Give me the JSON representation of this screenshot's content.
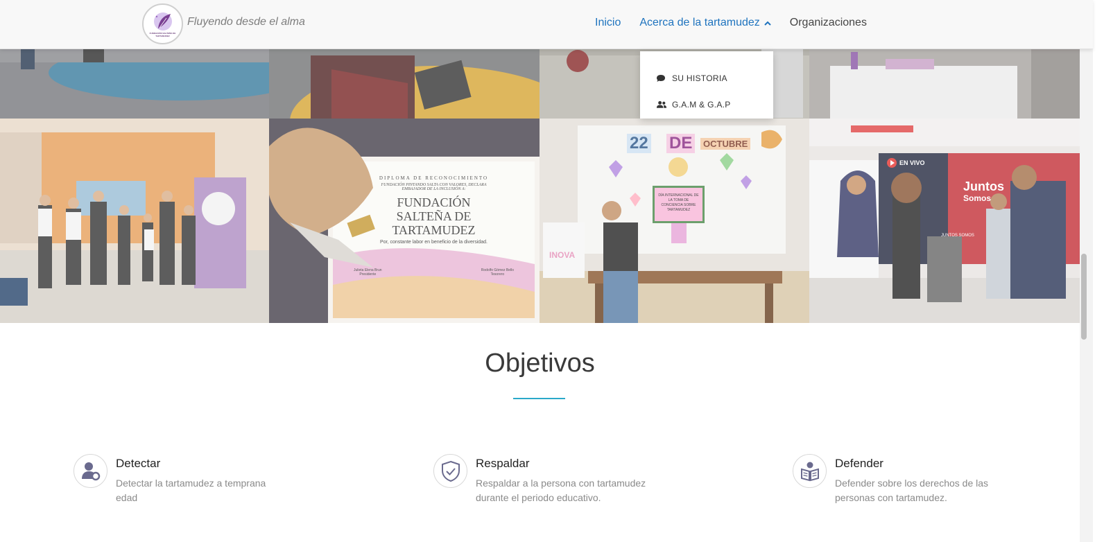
{
  "header": {
    "tagline": "Fluyendo desde el alma",
    "logo_text": "FUNDACIÓN SALTEÑA DE TARTAMUDEZ"
  },
  "nav": {
    "items": [
      {
        "label": "Inicio",
        "active": true
      },
      {
        "label": "Acerca de la tartamudez",
        "active": true,
        "expanded": true
      },
      {
        "label": "Organizaciones",
        "active": false
      }
    ]
  },
  "dropdown": {
    "items": [
      {
        "label": "SU HISTORIA",
        "icon": "comment-icon"
      },
      {
        "label": "G.A.M & G.A.P",
        "icon": "users-icon"
      }
    ]
  },
  "gallery": {
    "certificate": {
      "heading": "DIPLOMA DE RECONOCIMIENTO",
      "line1": "FUNDACIÓN PINTANDO SALTA CON VALORES, DECLARA",
      "line2": "EMBAJADOR DE LA INCLUSIÓN A:",
      "name1": "FUNDACIÓN",
      "name2": "SALTEÑA DE",
      "name3": "TARTAMUDEZ",
      "footer": "Por, constante labor en beneficio de la diversidad.",
      "signer1": "Julieta Elena Brun",
      "signer1_role": "Presidente",
      "signer2": "Rodolfo Gómez Bello",
      "signer2_role": "Tesorero"
    },
    "board": {
      "day": "22",
      "de": "DE",
      "month": "OCTUBRE",
      "sign": "DÍA INTERNACIONAL DE LA TOMA DE CONCIENCIA SOBRE TARTAMUDEZ",
      "bag": "INOVA"
    },
    "tv": {
      "live": "EN VIVO",
      "title1": "Juntos",
      "title2": "Somos",
      "tag": "JUNTOS SOMOS"
    }
  },
  "objectives": {
    "title": "Objetivos",
    "items": [
      {
        "title": "Detectar",
        "text": "Detectar la tartamudez a temprana edad",
        "icon": "user-search-icon"
      },
      {
        "title": "Respaldar",
        "text": "Respaldar a la persona con tartamudez durante el periodo educativo.",
        "icon": "shield-check-icon"
      },
      {
        "title": "Defender",
        "text": "Defender sobre los derechos de las personas con tartamudez.",
        "icon": "book-reader-icon"
      }
    ]
  },
  "colors": {
    "link": "#1e73be",
    "accent_divider": "#2aa8c9",
    "icon": "#6a6a8e"
  }
}
